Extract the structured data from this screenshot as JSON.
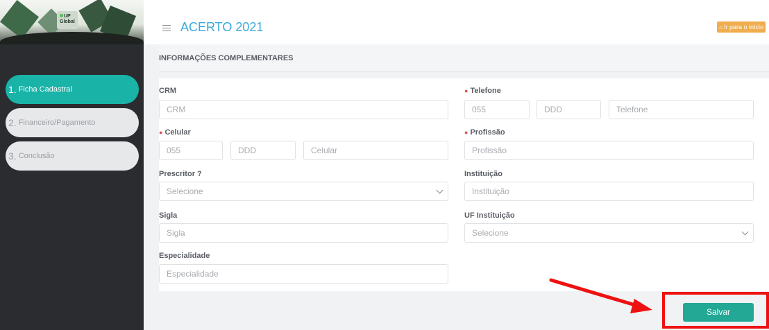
{
  "sidebar": {
    "banner_logo_text": "UP Global",
    "steps": [
      {
        "num": "1.",
        "label": "Ficha Cadastral",
        "active": true
      },
      {
        "num": "2.",
        "label": "Financeiro/Pagamento",
        "active": false
      },
      {
        "num": "3.",
        "label": "Conclusão",
        "active": false
      }
    ]
  },
  "header": {
    "title": "ACERTO 2021",
    "home_button": "Ir para o início"
  },
  "section": {
    "title": "INFORMAÇÕES COMPLEMENTARES"
  },
  "form": {
    "crm": {
      "label": "CRM",
      "placeholder": "CRM"
    },
    "telefone": {
      "label": "Telefone",
      "required": true,
      "ddi_placeholder": "055",
      "ddd_placeholder": "DDD",
      "number_placeholder": "Telefone"
    },
    "celular": {
      "label": "Celular",
      "required": true,
      "ddi_placeholder": "055",
      "ddd_placeholder": "DDD",
      "number_placeholder": "Celular"
    },
    "profissao": {
      "label": "Profissão",
      "required": true,
      "placeholder": "Profissão"
    },
    "prescritor": {
      "label": "Prescritor ?",
      "selected": "Selecione"
    },
    "instituicao": {
      "label": "Instituição",
      "placeholder": "Instituição"
    },
    "sigla": {
      "label": "Sigla",
      "placeholder": "Sigla"
    },
    "uf_instituicao": {
      "label": "UF Instituição",
      "selected": "Selecione"
    },
    "especialidade": {
      "label": "Especialidade",
      "placeholder": "Especialidade"
    }
  },
  "actions": {
    "save_label": "Salvar"
  },
  "colors": {
    "accent": "#1ab3a8",
    "title": "#3aa9d9",
    "home_button": "#f0ad4e",
    "save_button": "#24a896",
    "highlight": "#ee1111"
  }
}
